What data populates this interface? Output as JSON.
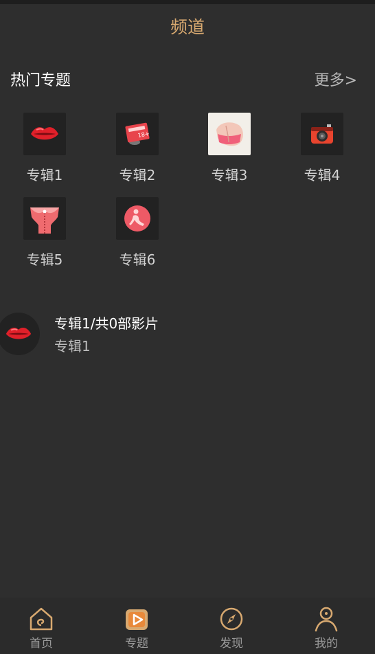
{
  "header": {
    "title": "频道"
  },
  "section": {
    "title": "热门专题",
    "more": "更多>"
  },
  "albums": [
    {
      "label": "专辑1",
      "icon": "lips-icon"
    },
    {
      "label": "专辑2",
      "icon": "adult-card-icon"
    },
    {
      "label": "专辑3",
      "icon": "hips-icon"
    },
    {
      "label": "专辑4",
      "icon": "camera-icon"
    },
    {
      "label": "专辑5",
      "icon": "lingerie-icon"
    },
    {
      "label": "专辑6",
      "icon": "pose-icon"
    }
  ],
  "list": [
    {
      "title": "专辑1/共0部影片",
      "subtitle": "专辑1",
      "icon": "lips-icon"
    }
  ],
  "nav": [
    {
      "label": "首页",
      "icon": "home-icon"
    },
    {
      "label": "专题",
      "icon": "play-icon"
    },
    {
      "label": "发现",
      "icon": "compass-icon"
    },
    {
      "label": "我的",
      "icon": "person-icon"
    }
  ],
  "colors": {
    "background": "#2e2e2e",
    "accent": "#d8a970",
    "tile_bg": "#222222",
    "nav_label": "#9a9a9a"
  }
}
